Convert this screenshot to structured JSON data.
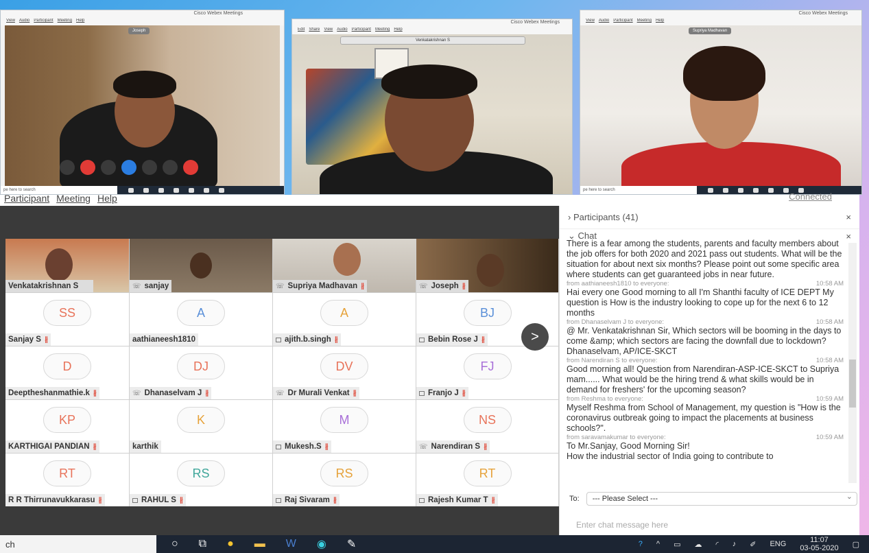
{
  "windows": [
    {
      "title": "Cisco Webex Meetings",
      "menus": [
        "View",
        "Audio",
        "Participant",
        "Meeting",
        "Help"
      ],
      "speaker": "Joseph",
      "search_placeholder": "pe here to search"
    },
    {
      "title": "Cisco Webex Meetings",
      "menus": [
        "Edit",
        "Share",
        "View",
        "Audio",
        "Participant",
        "Meeting",
        "Help"
      ],
      "speaker": "Venkatakrishnan S"
    },
    {
      "title": "Cisco Webex Meetings",
      "menus": [
        "View",
        "Audio",
        "Participant",
        "Meeting",
        "Help"
      ],
      "speaker": "Supriya Madhavan",
      "search_placeholder": "pe here to search"
    }
  ],
  "main": {
    "menus": [
      "Participant",
      "Meeting",
      "Help"
    ],
    "status": "Connected",
    "video_tiles": [
      {
        "name": "Venkatakrishnan S"
      },
      {
        "name": "sanjay"
      },
      {
        "name": "Supriya Madhavan"
      },
      {
        "name": "Joseph"
      }
    ],
    "participants": [
      {
        "initials": "SS",
        "name": "Sanjay S",
        "color": "#e8735a"
      },
      {
        "initials": "A",
        "name": "aathianeesh1810",
        "color": "#5a8fd8"
      },
      {
        "initials": "A",
        "name": "ajith.b.singh",
        "color": "#e6a23a"
      },
      {
        "initials": "BJ",
        "name": "Bebin Rose J",
        "color": "#5a8fd8"
      },
      {
        "initials": "D",
        "name": "Deeptheshanmathie.k",
        "color": "#e8735a"
      },
      {
        "initials": "DJ",
        "name": "Dhanaselvam J",
        "color": "#e8735a"
      },
      {
        "initials": "DV",
        "name": "Dr Murali Venkat",
        "color": "#e8735a"
      },
      {
        "initials": "FJ",
        "name": "Franjo J",
        "color": "#a86fd8"
      },
      {
        "initials": "KP",
        "name": "KARTHIGAI PANDIAN",
        "color": "#e8735a"
      },
      {
        "initials": "K",
        "name": "karthik",
        "color": "#e6a23a"
      },
      {
        "initials": "M",
        "name": "Mukesh.S",
        "color": "#a86fd8"
      },
      {
        "initials": "NS",
        "name": "Narendiran S",
        "color": "#e8735a"
      },
      {
        "initials": "RT",
        "name": "R R Thirrunavukkarasu",
        "color": "#e8735a"
      },
      {
        "initials": "RS",
        "name": "RAHUL S",
        "color": "#3fa69a"
      },
      {
        "initials": "RS",
        "name": "Raj Sivaram",
        "color": "#e6a23a"
      },
      {
        "initials": "RT",
        "name": "Rajesh Kumar T",
        "color": "#e6a23a"
      }
    ],
    "next_label": ">"
  },
  "panel": {
    "participants_header": "Participants (41)",
    "chat_header": "Chat",
    "close_icon": "×",
    "messages": [
      {
        "from": "",
        "time": "",
        "text": "There is a fear among the students, parents and faculty members about the job offers for both 2020 and 2021 pass out students. What will be the situation for about next six months? Please point out some specific area where students can get guaranteed jobs in near future."
      },
      {
        "from": "from aathianeesh1810 to everyone:",
        "time": "10:58 AM",
        "text": "Hai every one Good morning to all  I'm Shanthi faculty of ICE DEPT                My question is How is the industry looking to cope up for the next 6 to 12 months"
      },
      {
        "from": "from Dhanaselvam J to everyone:",
        "time": "10:58 AM",
        "text": "@ Mr. Venkatakrishnan Sir,   Which sectors will be booming in the days to come &amp; which sectors are facing the downfall due to lockdown?  Dhanaselvam, AP/ICE-SKCT"
      },
      {
        "from": "from Narendiran S to everyone:",
        "time": "10:58 AM",
        "text": "Good morning all! Question from Narendiran-ASP-ICE-SKCT to Supriya mam...... What would be the hiring trend & what skills would be in demand for freshers' for the upcoming season?"
      },
      {
        "from": "from Reshma to everyone:",
        "time": "10:59 AM",
        "text": "Myself Reshma from School of Management, my question is \"How is the coronavirus outbreak going to impact the placements at business schools?\"."
      },
      {
        "from": "from saravamakumar to everyone:",
        "time": "10:59 AM",
        "text": "To Mr.Sanjay, Good Morning Sir!"
      },
      {
        "from": "",
        "time": "",
        "text": "How the industrial sector of India going to contribute to"
      }
    ],
    "to_label": "To:",
    "to_select": "--- Please Select ---",
    "input_placeholder": "Enter chat message here"
  },
  "taskbar": {
    "search_text": "ch",
    "lang": "ENG",
    "time": "11:07",
    "date": "03-05-2020"
  }
}
